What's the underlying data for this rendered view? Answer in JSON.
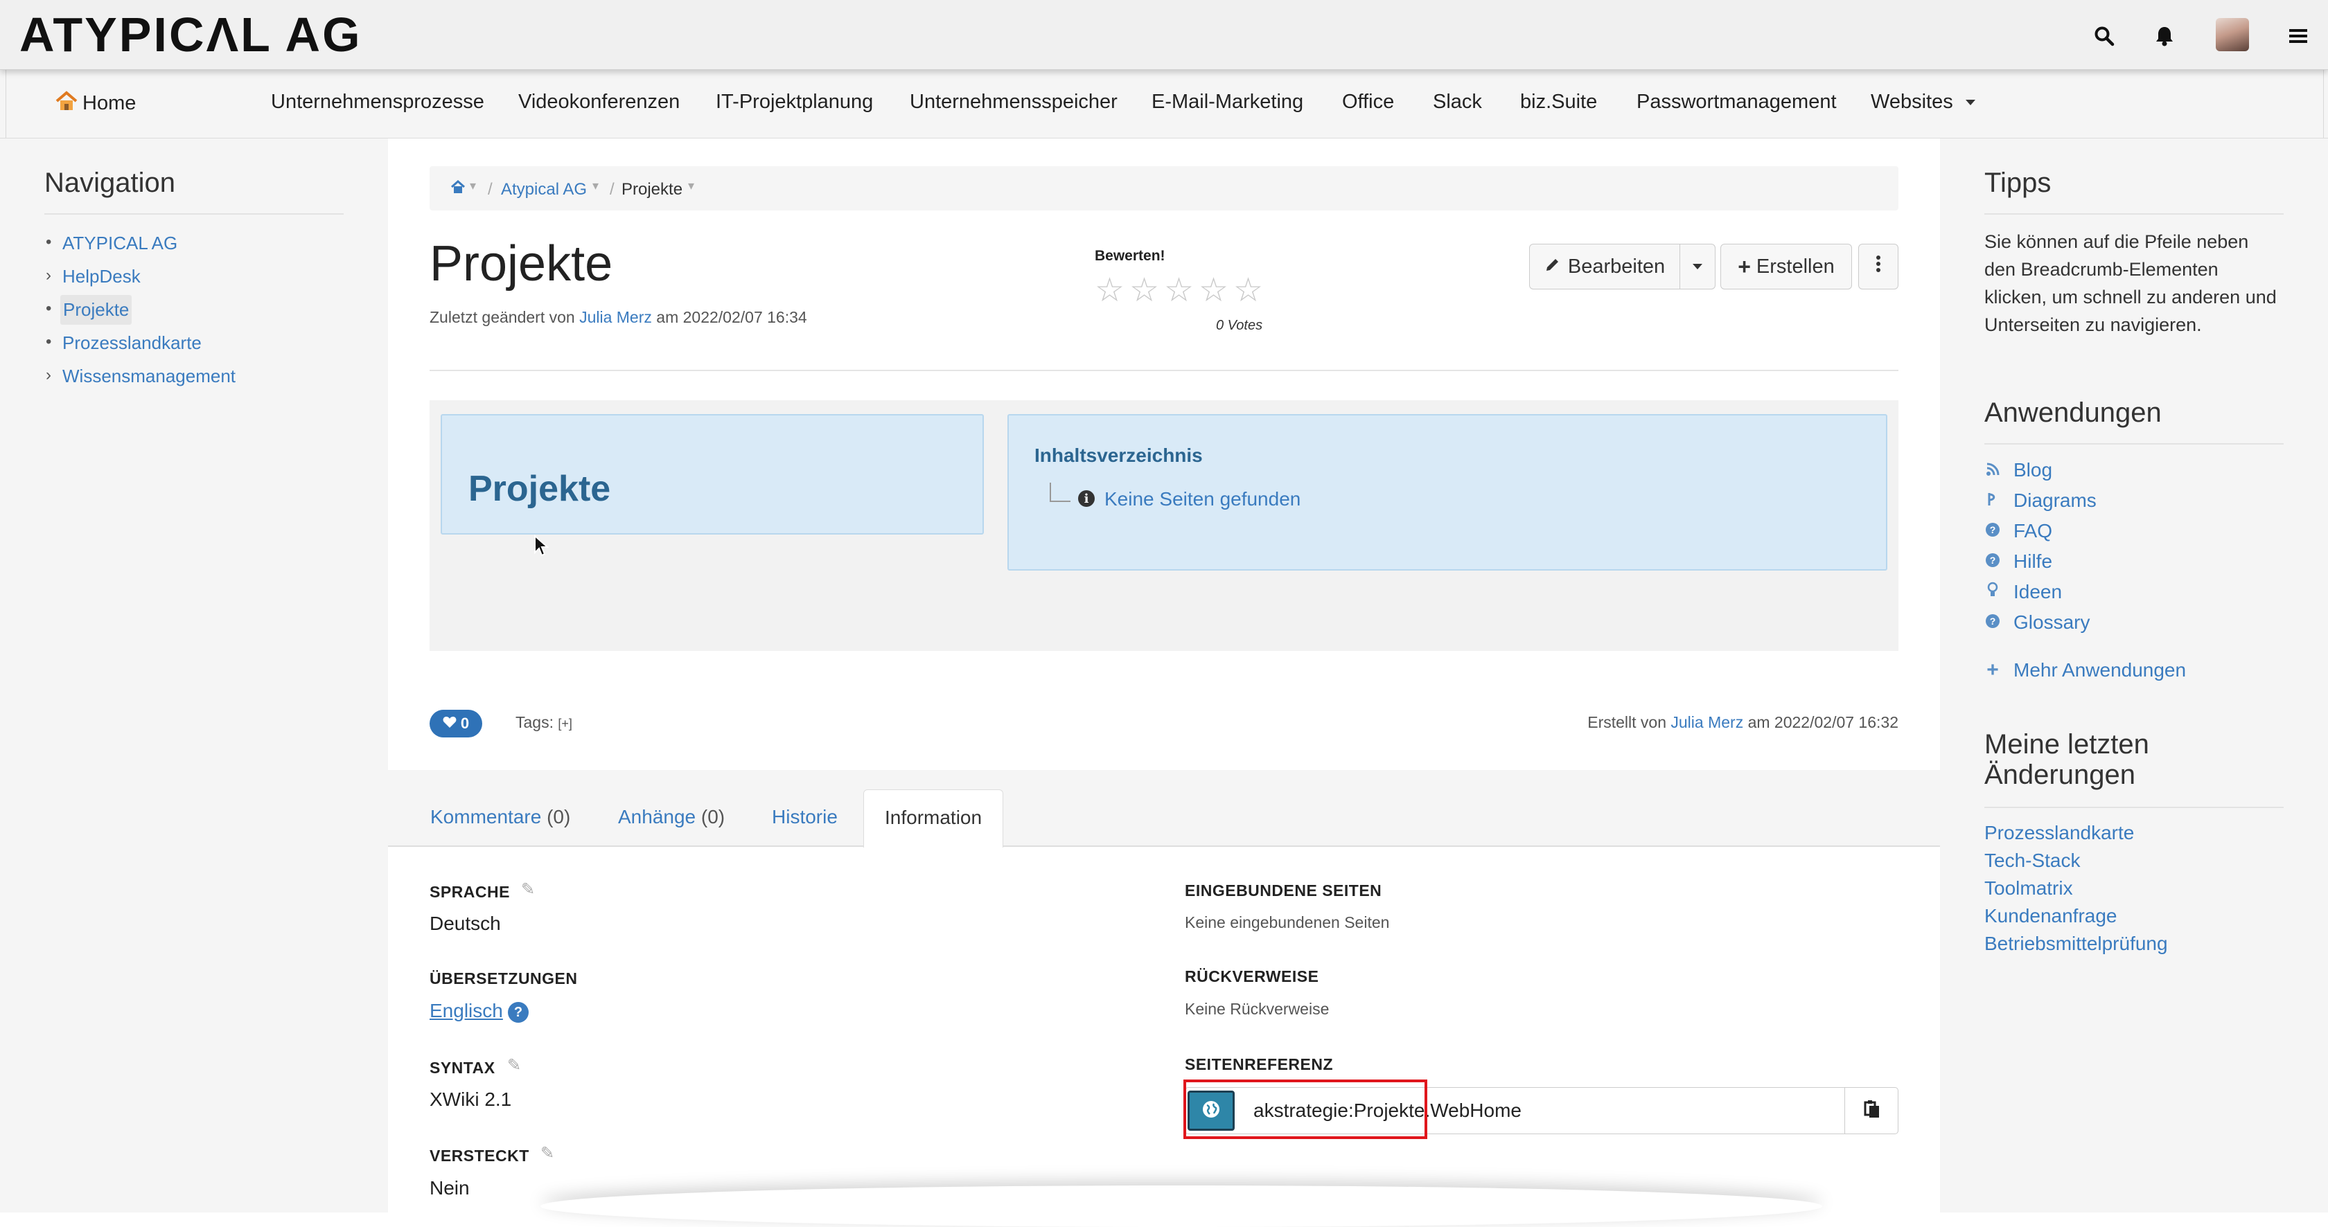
{
  "brand": "ATYPICΛL AG",
  "topbar": {
    "search_icon": "search-icon",
    "bell_icon": "bell-icon",
    "menu_icon": "hamburger-icon"
  },
  "menu": {
    "home": "Home",
    "items": [
      "Unternehmensprozesse",
      "Videokonferenzen",
      "IT-Projektplanung",
      "Unternehmensspeicher",
      "E-Mail-Marketing",
      "Office",
      "Slack",
      "biz.Suite",
      "Passwortmanagement",
      "Websites"
    ]
  },
  "navigation": {
    "title": "Navigation",
    "items": [
      {
        "label": "ATYPICAL AG",
        "marker": "•"
      },
      {
        "label": "HelpDesk",
        "marker": "›"
      },
      {
        "label": "Projekte",
        "marker": "•"
      },
      {
        "label": "Prozesslandkarte",
        "marker": "•"
      },
      {
        "label": "Wissensmanagement",
        "marker": "›"
      }
    ]
  },
  "breadcrumb": {
    "sep": "/",
    "crumb1": "Atypical AG",
    "crumb2": "Projekte"
  },
  "page": {
    "title": "Projekte",
    "modified_prefix": "Zuletzt geändert von",
    "modified_author": "Julia Merz",
    "modified_suffix": "am 2022/02/07 16:34"
  },
  "rating": {
    "label": "Bewerten!",
    "votes": "0 Votes",
    "stars": "☆"
  },
  "actions": {
    "edit": "Bearbeiten",
    "create": "Erstellen"
  },
  "content": {
    "box_title": "Projekte",
    "toc_title": "Inhaltsverzeichnis",
    "toc_empty": "Keine Seiten gefunden"
  },
  "footer": {
    "likes": "0",
    "tags_label": "Tags:",
    "tags_add": "[+]",
    "created_prefix": "Erstellt von",
    "created_author": "Julia Merz",
    "created_suffix": "am 2022/02/07 16:32"
  },
  "tabs": {
    "comments": "Kommentare",
    "comments_count": "(0)",
    "attachments": "Anhänge",
    "attachments_count": "(0)",
    "history": "Historie",
    "information": "Information"
  },
  "info": {
    "sprache_label": "SPRACHE",
    "sprache_value": "Deutsch",
    "uebersetzungen_label": "ÜBERSETZUNGEN",
    "uebersetzungen_value": "Englisch",
    "help": "?",
    "syntax_label": "SYNTAX",
    "syntax_value": "XWiki 2.1",
    "versteckt_label": "VERSTECKT",
    "versteckt_value": "Nein",
    "eingebunden_label": "EINGEBUNDENE SEITEN",
    "eingebunden_value": "Keine eingebundenen Seiten",
    "rueckverweise_label": "RÜCKVERWEISE",
    "rueckverweise_value": "Keine Rückverweise",
    "seitenreferenz_label": "SEITENREFERENZ",
    "seitenreferenz_value": "akstrategie:Projekte.WebHome"
  },
  "tips": {
    "title": "Tipps",
    "text": "Sie können auf die Pfeile neben den Breadcrumb-Elementen klicken, um schnell zu anderen und Unterseiten zu navigieren."
  },
  "apps": {
    "title": "Anwendungen",
    "items": [
      {
        "label": "Blog",
        "icon": "rss-icon"
      },
      {
        "label": "Diagrams",
        "icon": "diagram-icon"
      },
      {
        "label": "FAQ",
        "icon": "question-circle-icon"
      },
      {
        "label": "Hilfe",
        "icon": "question-circle-icon"
      },
      {
        "label": "Ideen",
        "icon": "lightbulb-icon"
      },
      {
        "label": "Glossary",
        "icon": "question-circle-icon"
      }
    ],
    "more": "Mehr Anwendungen"
  },
  "recent": {
    "title": "Meine letzten Änderungen",
    "items": [
      "Prozesslandkarte",
      "Tech-Stack",
      "Toolmatrix",
      "Kundenanfrage",
      "Betriebsmittelprüfung"
    ]
  },
  "colors": {
    "link": "#3a7bbf",
    "accent_blue": "#2f72b7",
    "box_fill": "#d9eaf7",
    "highlight": "#e0161c"
  }
}
